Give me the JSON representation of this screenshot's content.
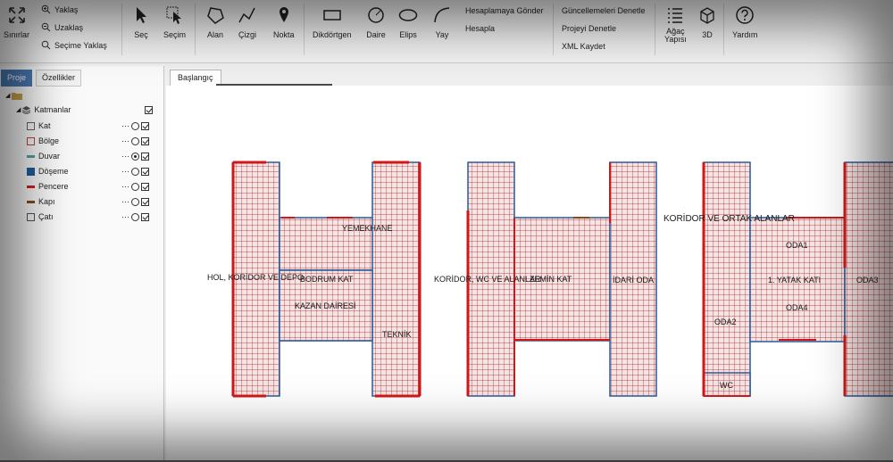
{
  "ribbon": {
    "zoom_bounds": "Sınırlar",
    "zoom_in": "Yaklaş",
    "zoom_out": "Uzaklaş",
    "zoom_selection": "Seçime Yaklaş",
    "select": "Seç",
    "selection": "Seçim",
    "area": "Alan",
    "line": "Çizgi",
    "point": "Nokta",
    "rectangle": "Dikdörtgen",
    "circle": "Daire",
    "ellipse": "Elips",
    "arc": "Yay",
    "send_to_calc": "Hesaplamaya Gönder",
    "calculate": "Hesapla",
    "check_updates": "Güncellemeleri Denetle",
    "check_project": "Projeyi Denetle",
    "save_xml": "XML Kaydet",
    "tree_line1": "Ağaç",
    "tree_line2": "Yapısı",
    "three_d": "3D",
    "help": "Yardım"
  },
  "panel_tabs": {
    "project": "Proje",
    "properties": "Özellikler"
  },
  "tree": {
    "layers_label": "Katmanlar",
    "items": [
      {
        "label": "Kat",
        "icon": "floor-icon",
        "color": "#666666",
        "radio_on": false
      },
      {
        "label": "Bölge",
        "icon": "zone-icon",
        "color": "#c04040",
        "radio_on": false
      },
      {
        "label": "Duvar",
        "icon": "wall-icon",
        "color": "#5aa0a0",
        "radio_on": true
      },
      {
        "label": "Döşeme",
        "icon": "slab-icon",
        "color": "#1f5f9f",
        "radio_on": false
      },
      {
        "label": "Pencere",
        "icon": "window-icon",
        "color": "#d02020",
        "radio_on": false
      },
      {
        "label": "Kapı",
        "icon": "door-icon",
        "color": "#8a4a1a",
        "radio_on": false
      },
      {
        "label": "Çatı",
        "icon": "roof-icon",
        "color": "#555555",
        "radio_on": false
      }
    ],
    "dots": "···"
  },
  "doc_tab": "Başlangıç",
  "plan_labels": {
    "b1": [
      "YEMEKHANE",
      "HOL, KORİDOR VE DEPO",
      "BODRUM KAT",
      "KAZAN DAİRESİ",
      "TEKNİK"
    ],
    "b2": [
      "KORİDOR, WC VE ALANLAR",
      "ZEMİN KAT",
      "İDARİ ODA"
    ],
    "b3": [
      "KORİDOR VE ORTAK ALANLAR",
      "ODA1",
      "1. YATAK KATI",
      "ODA3",
      "ODA4",
      "ODA2",
      "WC"
    ]
  },
  "colors": {
    "grid": "#a42020",
    "fill": "#f6e4e4",
    "blue": "#2a5a9a",
    "red": "#d01818"
  }
}
